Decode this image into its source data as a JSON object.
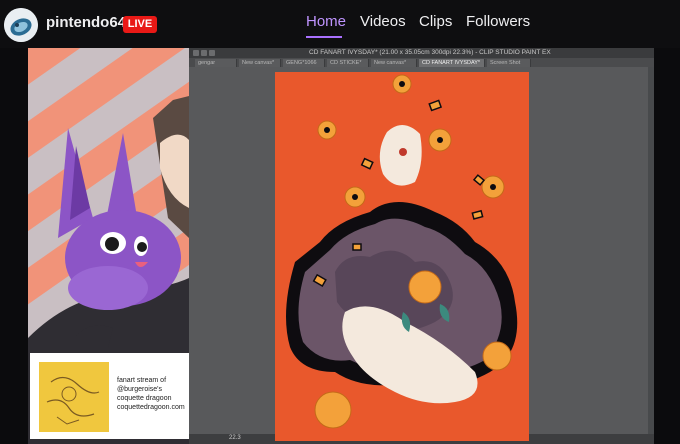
{
  "header": {
    "channel_name": "pintendo64",
    "live_badge": "LIVE",
    "tabs": [
      {
        "label": "Home",
        "active": true
      },
      {
        "label": "Videos",
        "active": false
      },
      {
        "label": "Clips",
        "active": false
      },
      {
        "label": "Followers",
        "active": false
      }
    ]
  },
  "colors": {
    "accent": "#a970ff",
    "live": "#e91916",
    "canvas_bg": "#e9582c"
  },
  "app_window": {
    "title": "CD FANART IVYSDAY* (21.00 x 35.05cm 300dpi 22.3%) - CLIP STUDIO PAINT EX",
    "tabs": [
      {
        "label": "gengar",
        "active": false
      },
      {
        "label": "New canvas*",
        "active": false
      },
      {
        "label": "GENG*1066",
        "active": false
      },
      {
        "label": "CD STICKE*",
        "active": false
      },
      {
        "label": "New canvas*",
        "active": false
      },
      {
        "label": "CD FANART IVYSDAY*",
        "active": true
      },
      {
        "label": "Screen Shot",
        "active": false
      }
    ],
    "zoom": "22.3"
  },
  "info_card": {
    "lines": [
      "fanart stream of",
      "@burgeroise's",
      "coquette dragoon",
      "coquettedragoon.com"
    ]
  }
}
